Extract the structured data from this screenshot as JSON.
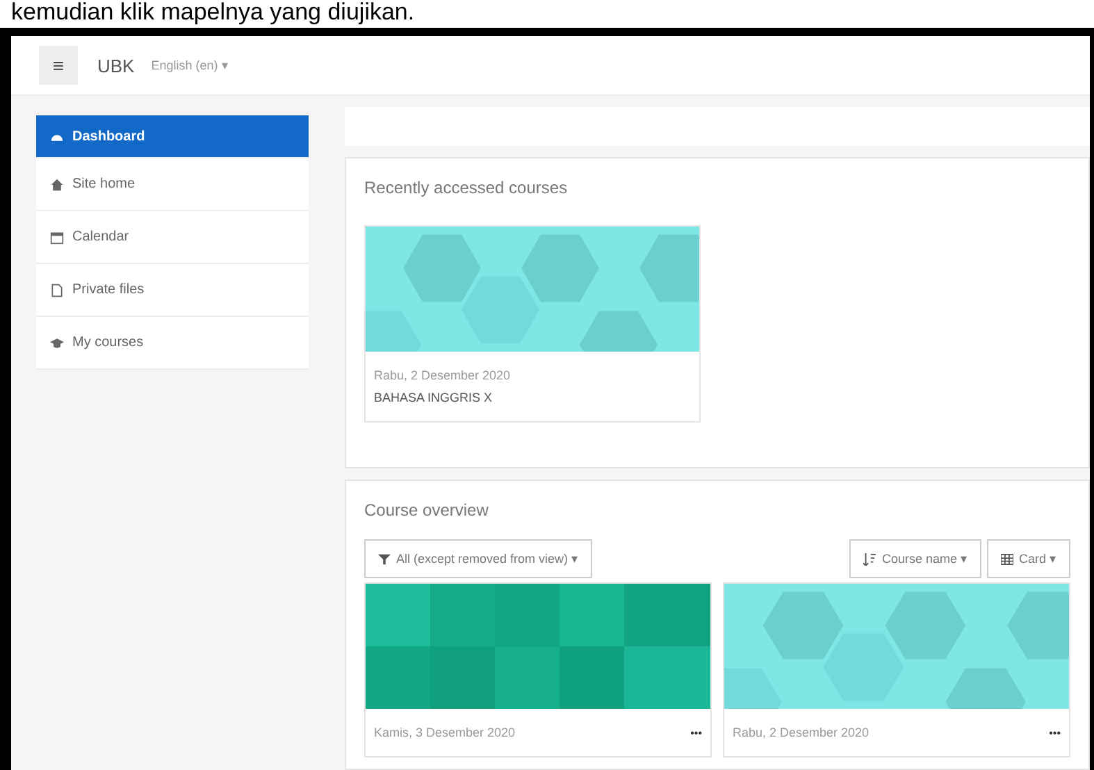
{
  "caption": "kemudian klik mapelnya yang diujikan.",
  "navbar": {
    "menu_icon": "≡",
    "site_name": "UBK",
    "language": "English (en) ▾"
  },
  "sidebar": {
    "items": [
      {
        "label": "Dashboard",
        "kind": "dashboard",
        "selected": true
      },
      {
        "label": "Site home",
        "kind": "home",
        "selected": false
      },
      {
        "label": "Calendar",
        "kind": "calendar",
        "selected": false
      },
      {
        "label": "Private files",
        "kind": "file",
        "selected": false
      },
      {
        "label": "My courses",
        "kind": "cap",
        "selected": false
      }
    ]
  },
  "recent": {
    "title": "Recently accessed courses",
    "courses": [
      {
        "date": "Rabu, 2 Desember 2020",
        "name": "BAHASA INGGRIS X",
        "kind": "hex"
      }
    ]
  },
  "overview": {
    "title": "Course overview",
    "filter": "All (except removed from view) ▾",
    "sort": "Course name ▾",
    "view": "Card ▾",
    "courses": [
      {
        "date": "Kamis, 3 Desember 2020",
        "menu": "•••",
        "kind": "squares"
      },
      {
        "date": "Rabu, 2 Desember 2020",
        "menu": "•••",
        "kind": "hex"
      }
    ]
  }
}
